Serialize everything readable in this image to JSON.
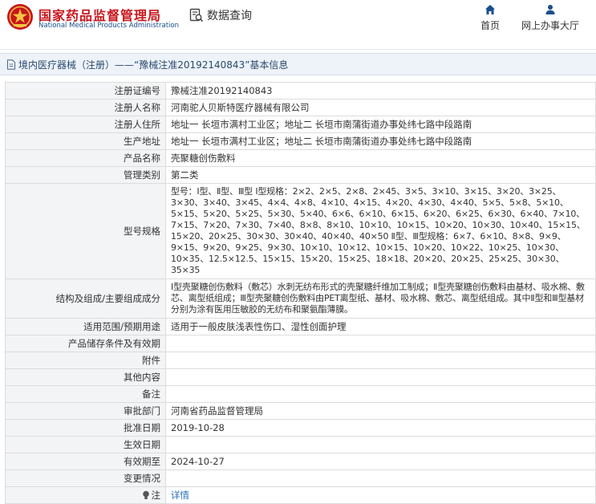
{
  "header": {
    "brand_cn": "国家药品监督管理局",
    "brand_en": "National Medical Products Administration",
    "data_query": "数据查询",
    "nav": {
      "home": "首页",
      "office": "网上办事大厅"
    },
    "accent": "#c8161d",
    "nav_color": "#1a4e8c"
  },
  "breadcrumb": {
    "text": "境内医疗器械（注册）——“豫械注准20192140843”基本信息"
  },
  "detail": {
    "rows": [
      {
        "label": "注册证编号",
        "value": "豫械注准20192140843"
      },
      {
        "label": "注册人名称",
        "value": "河南驼人贝斯特医疗器械有限公司"
      },
      {
        "label": "注册人住所",
        "value": "地址一 长垣市满村工业区；地址二 长垣市南蒲街道办事处纬七路中段路南"
      },
      {
        "label": "生产地址",
        "value": "地址一 长垣市满村工业区；地址二 长垣市南蒲街道办事处纬七路中段路南"
      },
      {
        "label": "产品名称",
        "value": "壳聚糖创伤敷料"
      },
      {
        "label": "管理类别",
        "value": "第二类"
      },
      {
        "label": "型号规格",
        "value": "型号：Ⅰ型、Ⅱ型、Ⅲ型 Ⅰ型规格：2×2、2×5、2×8、2×45、3×5、3×10、3×15、3×20、3×25、3×30、3×40、3×45、4×4、4×8、4×10、4×15、4×20、4×30、4×40、5×5、5×8、5×10、5×15、5×20、5×25、5×30、5×40、6×6、6×10、6×15、6×20、6×25、6×30、6×40、7×10、7×15、7×20、7×30、7×40、8×8、8×10、10×10、10×15、10×20、10×30、10×40、15×15、15×20、20×25、30×30、30×40、40×40、40×50 Ⅱ型、Ⅲ型规格：6×7、6×10、8×8、9×9、9×15、9×20、9×25、9×30、10×10、10×12、10×15、10×20、10×22、10×25、10×30、10×35、12.5×12.5、15×15、15×20、15×25、18×18、20×20、20×25、25×25、30×30、35×35"
      },
      {
        "label": "结构及组成/主要组成成分",
        "value": "Ⅰ型壳聚糖创伤敷料（敷芯）水刺无纺布形式的壳聚糖纤维加工制成；Ⅱ型壳聚糖创伤敷料由基材、吸水棉、敷芯、离型纸组成；Ⅲ型壳聚糖创伤敷料由PET离型纸、基材、吸水棉、敷芯、离型纸组成。其中Ⅱ型和Ⅲ型基材分别为涂有医用压敏胶的无纺布和聚氨酯薄膜。"
      },
      {
        "label": "适用范围/预期用途",
        "value": "适用于一般皮肤浅表性伤口、湿性创面护理"
      },
      {
        "label": "产品储存条件及有效期",
        "value": ""
      },
      {
        "label": "附件",
        "value": ""
      },
      {
        "label": "其他内容",
        "value": ""
      },
      {
        "label": "备注",
        "value": ""
      },
      {
        "label": "审批部门",
        "value": "河南省药品监督管理局"
      },
      {
        "label": "批准日期",
        "value": "2019-10-28"
      },
      {
        "label": "生效日期",
        "value": ""
      },
      {
        "label": "有效期至",
        "value": "2024-10-27"
      },
      {
        "label": "变更情况",
        "value": ""
      }
    ],
    "note": {
      "label": "注",
      "link": "详情"
    }
  }
}
